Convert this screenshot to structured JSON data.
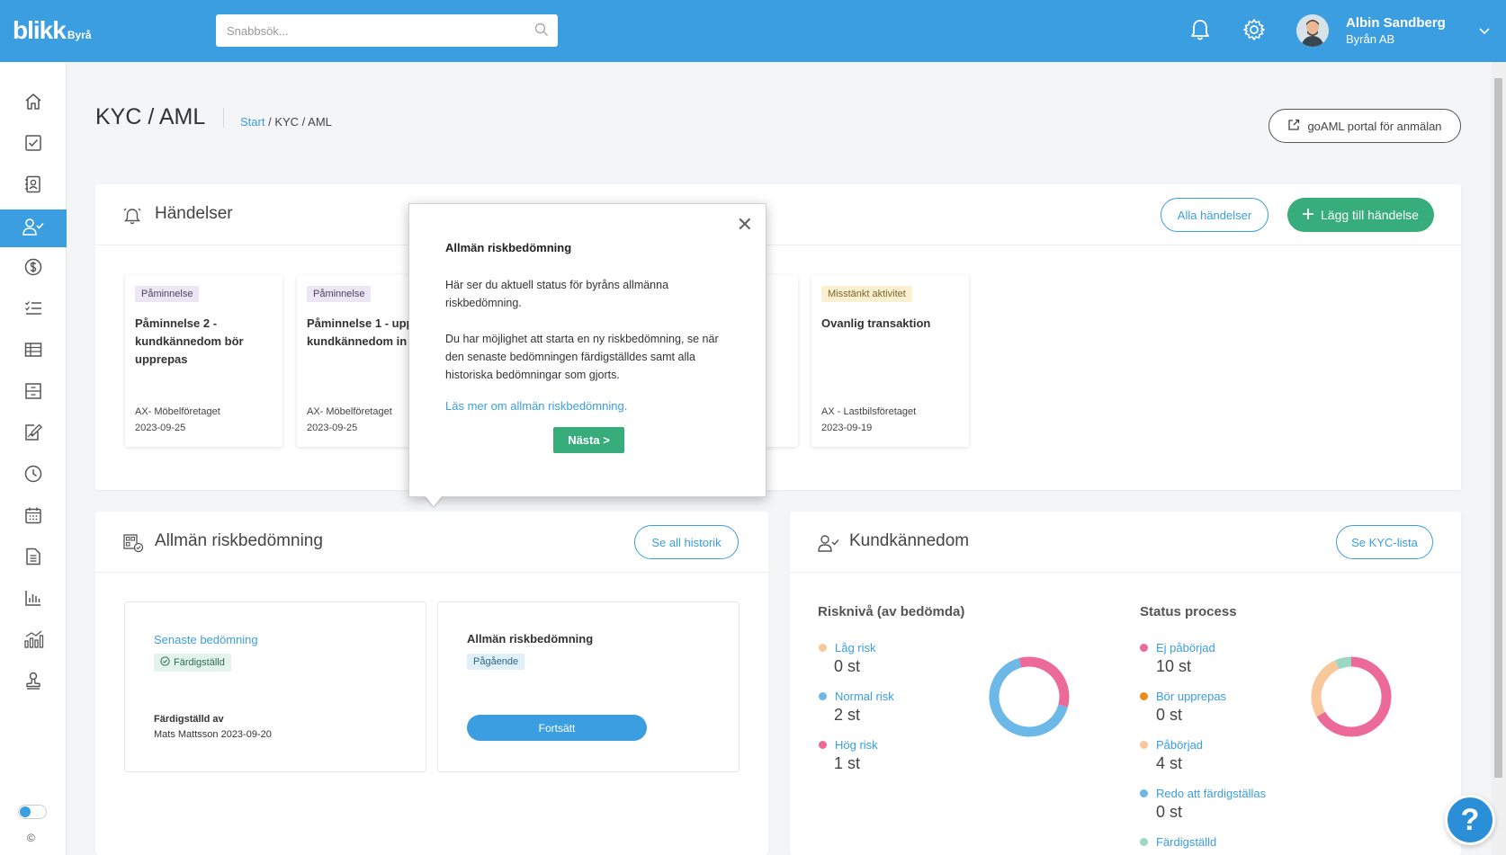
{
  "app": {
    "logo": "blikk",
    "logo_suffix": "Byrå"
  },
  "search": {
    "placeholder": "Snabbsök..."
  },
  "user": {
    "name": "Albin Sandberg",
    "org": "Byrån AB"
  },
  "header": {
    "title": "KYC / AML",
    "breadcrumb_start": "Start",
    "breadcrumb_sep": " / ",
    "breadcrumb_current": "KYC / AML",
    "goaml_button": "goAML portal för anmälan"
  },
  "sidebar": {
    "items": [
      {
        "icon": "home-icon"
      },
      {
        "icon": "checkbox-icon"
      },
      {
        "icon": "contacts-icon"
      },
      {
        "icon": "user-check-icon",
        "active": true
      },
      {
        "icon": "dollar-icon"
      },
      {
        "icon": "checklist-icon"
      },
      {
        "icon": "table-icon"
      },
      {
        "icon": "archive-icon"
      },
      {
        "icon": "document-edit-icon"
      },
      {
        "icon": "clock-icon"
      },
      {
        "icon": "calendar-icon"
      },
      {
        "icon": "file-icon"
      },
      {
        "icon": "bar-chart-icon"
      },
      {
        "icon": "analytics-icon"
      },
      {
        "icon": "stamp-icon"
      }
    ],
    "copyright": "©"
  },
  "events": {
    "title": "Händelser",
    "all_button": "Alla händelser",
    "add_button": "Lägg till händelse",
    "cards": [
      {
        "tag": "Påminnelse",
        "tag_color": "purple",
        "title": "Påminnelse 2 - kundkännedom bör upprepas",
        "company": "AX- Möbelföretaget",
        "date": "2023-09-25"
      },
      {
        "tag": "Påminnelse",
        "tag_color": "purple",
        "title": "Påminnelse 1 - upp kundkännedom in kort",
        "company": "AX- Möbelföretaget",
        "date": "2023-09-25"
      },
      {
        "tag": "Misstänkt aktivitet",
        "tag_color": "yellow",
        "title": "Ovanlig transaktion",
        "company": "AX - Lastbilsföretaget",
        "date": "2023-09-19"
      }
    ]
  },
  "risk": {
    "title": "Allmän riskbedömning",
    "history_button": "Se all historik",
    "latest_label": "Senaste bedömning",
    "latest_status": "Färdigställd",
    "completed_by_label": "Färdigställd av",
    "completed_by_value": "Mats Mattsson 2023-09-20",
    "current_title": "Allmän riskbedömning",
    "current_status": "Pågående",
    "continue_button": "Fortsätt"
  },
  "kyc": {
    "title": "Kundkännedom",
    "list_button": "Se KYC-lista",
    "risk_heading": "Risknivå (av bedömda)",
    "status_heading": "Status process",
    "risk_levels": [
      {
        "label": "Låg risk",
        "value": "0 st",
        "count": 0,
        "color": "#f8c89a"
      },
      {
        "label": "Normal risk",
        "value": "2 st",
        "count": 2,
        "color": "#6cb8e6"
      },
      {
        "label": "Hög risk",
        "value": "1 st",
        "count": 1,
        "color": "#ec6a98"
      }
    ],
    "statuses": [
      {
        "label": "Ej påbörjad",
        "value": "10 st",
        "count": 10,
        "color": "#ec6a98"
      },
      {
        "label": "Bör upprepas",
        "value": "0 st",
        "count": 0,
        "color": "#f08a1c"
      },
      {
        "label": "Påbörjad",
        "value": "4 st",
        "count": 4,
        "color": "#f8c89a"
      },
      {
        "label": "Redo att färdigställas",
        "value": "0 st",
        "count": 0,
        "color": "#6cb8e6"
      },
      {
        "label": "Färdigställd",
        "value": "",
        "count": 1,
        "color": "#9ad8c2"
      }
    ]
  },
  "popover": {
    "title": "Allmän riskbedömning",
    "text1": "Här ser du aktuell status för byråns allmänna riskbedömning.",
    "text2": "Du har möjlighet att starta en ny riskbedömning, se när den senaste bedömningen färdigställdes samt alla historiska bedömningar som gjorts.",
    "link": "Läs mer om allmän riskbedömning.",
    "next_button": "Nästa >",
    "close": "✕"
  },
  "help": {
    "label": "?"
  },
  "colors": {
    "brand": "#3a9ee0",
    "green": "#36ad7b"
  }
}
